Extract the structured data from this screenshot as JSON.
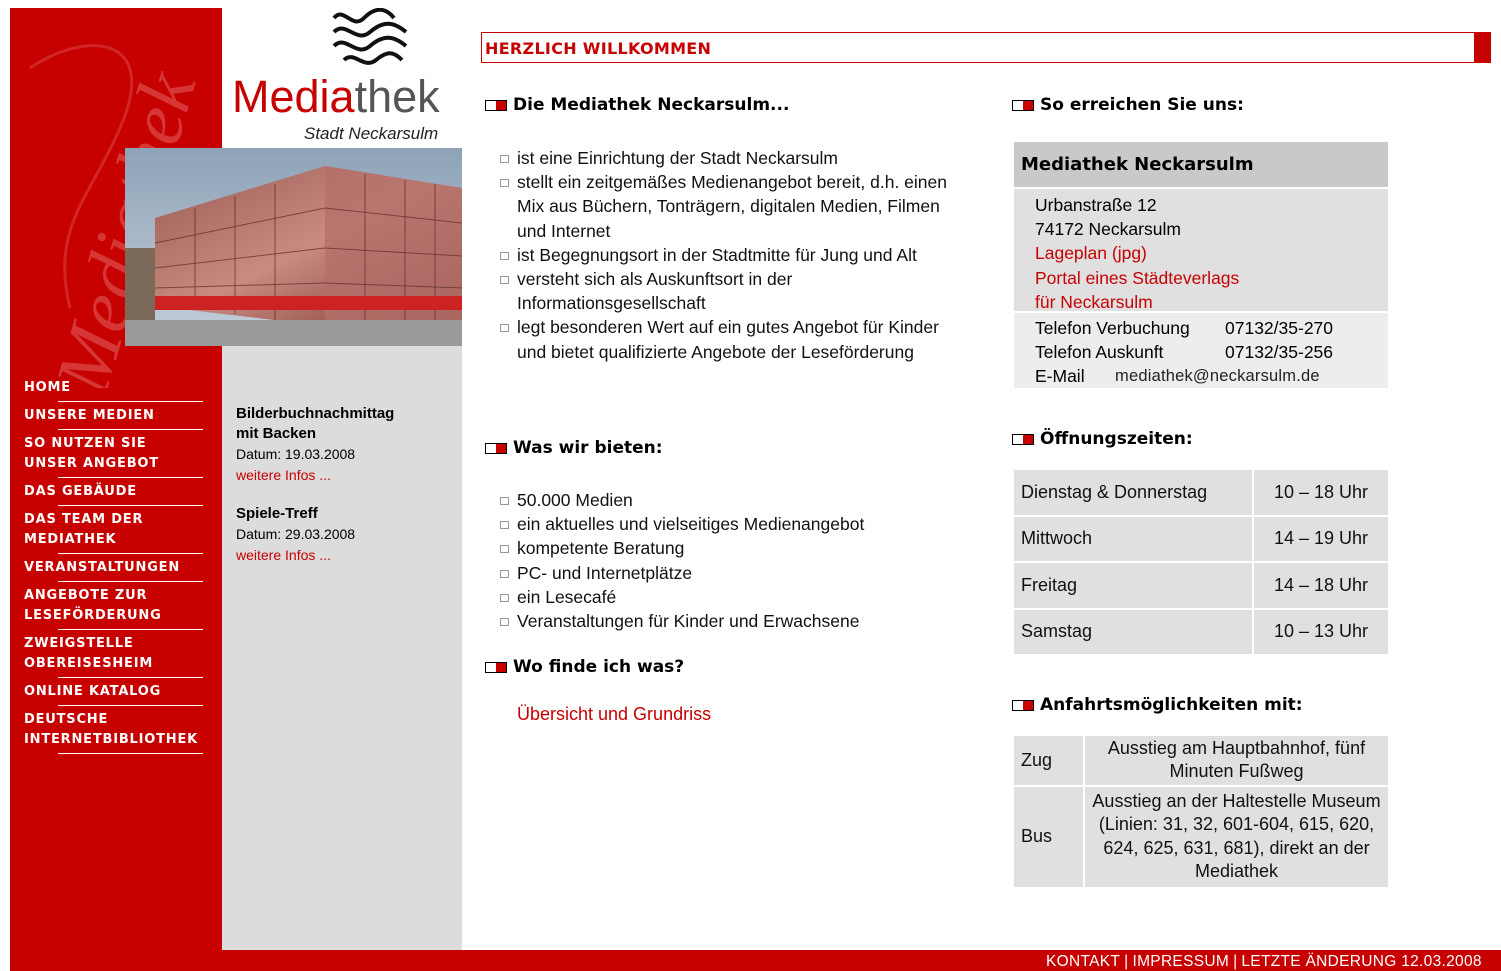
{
  "logo": {
    "title_part1": "Media",
    "title_part2": "thek",
    "subtitle": "Stadt Neckarsulm",
    "watermark_text": "Mediathek"
  },
  "nav": [
    {
      "label": "HOME",
      "id": "home"
    },
    {
      "label": "UNSERE MEDIEN",
      "id": "unsere-medien"
    },
    {
      "label": "SO NUTZEN SIE\nUNSER ANGEBOT",
      "id": "so-nutzen"
    },
    {
      "label": "DAS GEBÄUDE",
      "id": "gebaeude"
    },
    {
      "label": "DAS TEAM DER\nMEDIATHEK",
      "id": "team"
    },
    {
      "label": "VERANSTALTUNGEN",
      "id": "veranstaltungen"
    },
    {
      "label": "ANGEBOTE ZUR\nLESEFÖRDERUNG",
      "id": "lesefoerderung"
    },
    {
      "label": "ZWEIGSTELLE\nOBEREISESHEIM",
      "id": "zweigstelle"
    },
    {
      "label": "ONLINE KATALOG",
      "id": "online-katalog"
    },
    {
      "label": "DEUTSCHE\nINTERNETBIBLIOTHEK",
      "id": "internetbibliothek"
    }
  ],
  "events": [
    {
      "title": "Bilderbuchnachmittag\nmit Backen",
      "date": "Datum: 19.03.2008",
      "link": "weitere Infos ..."
    },
    {
      "title": "Spiele-Treff",
      "date": "Datum: 29.03.2008",
      "link": "weitere Infos ..."
    }
  ],
  "welcome": "HERZLICH WILLKOMMEN",
  "sections": {
    "about": {
      "heading": "Die Mediathek Neckarsulm...",
      "items": [
        "ist eine Einrichtung der Stadt Neckarsulm",
        "stellt ein zeitgemäßes Medienangebot bereit, d.h. einen Mix aus Büchern, Tonträgern, digitalen Medien, Filmen und Internet",
        "ist Begegnungsort in der Stadtmitte für Jung und Alt",
        "versteht sich als Auskunftsort in der Informationsgesellschaft",
        "legt besonderen Wert auf ein gutes Angebot für Kinder und bietet qualifizierte Angebote der Leseförderung"
      ]
    },
    "offer": {
      "heading": "Was wir bieten:",
      "items": [
        "50.000 Medien",
        "ein aktuelles und vielseitiges Medienangebot",
        "kompetente Beratung",
        "PC- und Internetplätze",
        "ein Lesecafé",
        "Veranstaltungen für Kinder und Erwachsene"
      ]
    },
    "find": {
      "heading": "Wo finde ich was?",
      "link": "Übersicht und Grundriss"
    },
    "reach": {
      "heading": "So erreichen Sie uns:"
    },
    "hours": {
      "heading": "Öffnungszeiten:"
    },
    "transport": {
      "heading": "Anfahrtsmöglichkeiten mit:"
    }
  },
  "contact": {
    "name": "Mediathek Neckarsulm",
    "street": "Urbanstraße 12",
    "city": "74172 Neckarsulm",
    "link1": "Lageplan (jpg)",
    "link2": "Portal eines Städteverlags",
    "link3": "für Neckarsulm",
    "phone1_label": "Telefon Verbuchung",
    "phone1": "07132/35-270",
    "phone2_label": "Telefon Auskunft",
    "phone2": "07132/35-256",
    "email_label": "E-Mail",
    "email": "mediathek@neckarsulm.de"
  },
  "hours": [
    {
      "day": "Dienstag & Donnerstag",
      "time": "10 – 18 Uhr"
    },
    {
      "day": "Mittwoch",
      "time": "14 – 19 Uhr"
    },
    {
      "day": "Freitag",
      "time": "14 – 18 Uhr"
    },
    {
      "day": "Samstag",
      "time": "10 – 13 Uhr"
    }
  ],
  "transport": [
    {
      "mode": "Zug",
      "desc": "Ausstieg am Hauptbahnhof, fünf Minuten Fußweg"
    },
    {
      "mode": "Bus",
      "desc": "Ausstieg an der Haltestelle Museum (Linien: 31, 32, 601-604, 615, 620, 624, 625, 631, 681), direkt an der Mediathek"
    }
  ],
  "footer": {
    "kontakt": "KONTAKT",
    "impressum": "IMPRESSUM",
    "changed": "LETZTE ÄNDERUNG 12.03.2008"
  },
  "colors": {
    "brand_red": "#c70000",
    "sidebar_gray": "#dcdcdc",
    "table_gray": "#e0e0e0"
  }
}
